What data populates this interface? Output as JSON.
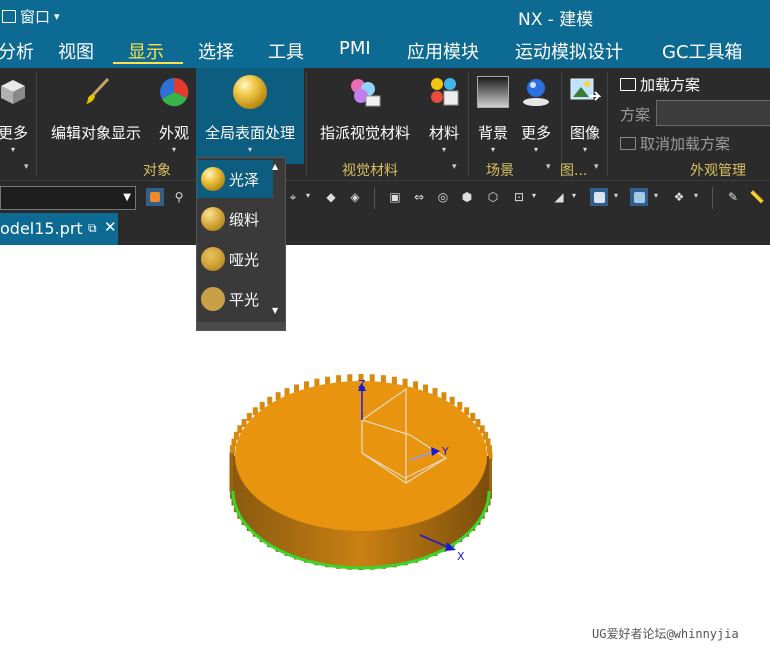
{
  "titlebar": {
    "quick_access": {
      "window_label": "窗口",
      "dropdown_glyph": "▾"
    },
    "app_title": "NX - 建模"
  },
  "menubar": {
    "items": [
      "分析",
      "视图",
      "显示",
      "选择",
      "工具",
      "PMI",
      "应用模块",
      "运动模拟设计",
      "GC工具箱"
    ],
    "active": "显示"
  },
  "ribbon": {
    "buttons": {
      "more_left": "更多",
      "edit_object_display": "编辑对象显示",
      "appearance": "外观",
      "global_surface": "全局表面处理",
      "assign_visual_material": "指派视觉材料",
      "material": "材料",
      "background": "背景",
      "more_scene": "更多",
      "image": "图像"
    },
    "groups": {
      "object": "对象",
      "visual_material": "视觉材料",
      "scene": "场景",
      "image_short": "图...",
      "appearance_mgmt": "外观管理"
    },
    "appearance_management": {
      "load_scheme": "加载方案",
      "scheme_label": "方案",
      "scheme_value": "",
      "unload_scheme": "取消加载方案"
    }
  },
  "surface_dropdown": {
    "items": [
      "光泽",
      "缎料",
      "哑光",
      "平光"
    ],
    "selected": "光泽"
  },
  "file_tab": {
    "name": "odel15.prt",
    "close_glyph": "✕"
  },
  "viewport": {
    "axis_labels": {
      "z": "Z",
      "y": "Y",
      "x": "X"
    },
    "gear_color": "#e8940f",
    "gear_edge_color": "#39d62b"
  },
  "watermark": "UG爱好者论坛@whinnyjia",
  "colors": {
    "accent_blue": "#0d6a93",
    "active_menu": "#ffe14a",
    "ribbon_bg": "#2b2b2b",
    "group_label": "#d8c060"
  }
}
